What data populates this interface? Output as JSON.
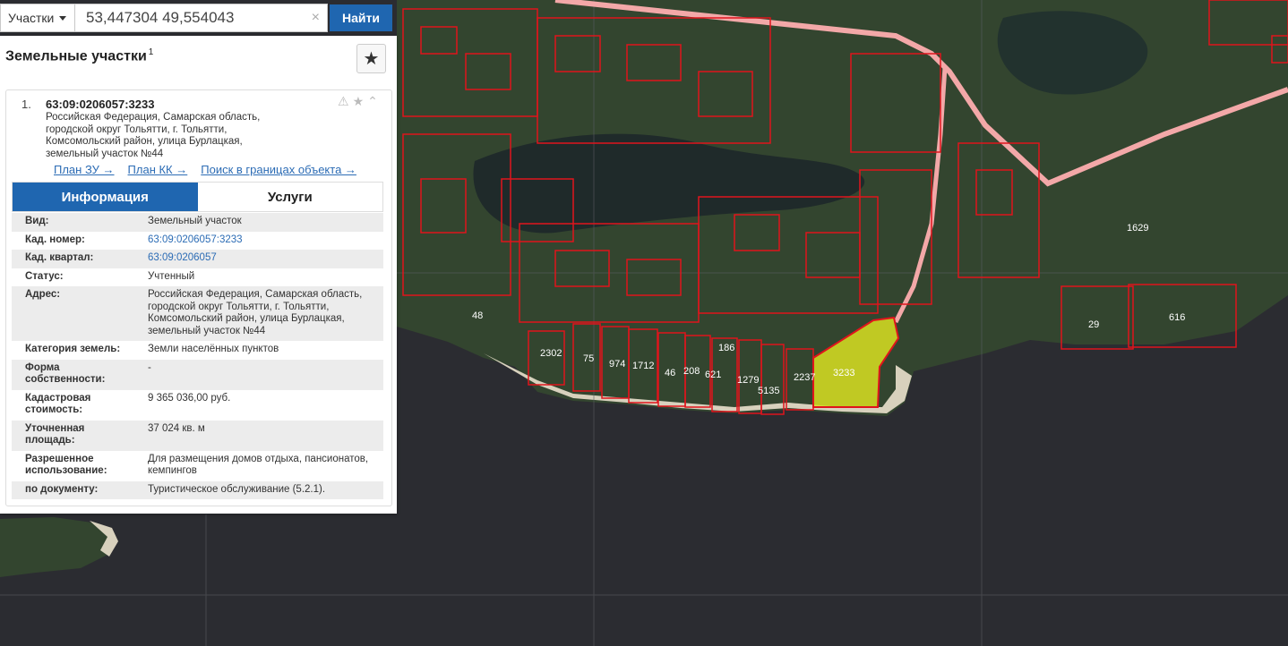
{
  "search": {
    "type_label": "Участки",
    "query": "53,447304 49,554043",
    "clear_symbol": "×",
    "button_label": "Найти"
  },
  "panel": {
    "title": "Земельные участки",
    "title_sup": "1",
    "favorite_icon": "star-icon"
  },
  "result": {
    "number": "1.",
    "cad_id": "63:09:0206057:3233",
    "address": "Российская Федерация, Самарская область, городской округ Тольятти, г. Тольятти, Комсомольский район, улица Бурлацкая, земельный участок №44",
    "icons": [
      "warning-icon",
      "star-icon",
      "chevron-up-icon"
    ],
    "links": {
      "plan_zu": "План ЗУ →",
      "plan_kk": "План КК →",
      "search_bounds": "Поиск в границах объекта →"
    }
  },
  "tabs": {
    "info": "Информация",
    "services": "Услуги"
  },
  "info_rows": [
    {
      "label": "Вид:",
      "value": "Земельный участок",
      "link": false
    },
    {
      "label": "Кад. номер:",
      "value": "63:09:0206057:3233",
      "link": true
    },
    {
      "label": "Кад. квартал:",
      "value": "63:09:0206057",
      "link": true
    },
    {
      "label": "Статус:",
      "value": "Учтенный",
      "link": false
    },
    {
      "label": "Адрес:",
      "value": "Российская Федерация, Самарская область, городской округ Тольятти, г. Тольятти, Комсомольский район, улица Бурлацкая, земельный участок №44",
      "link": false
    },
    {
      "label": "Категория земель:",
      "value": "Земли населённых пунктов",
      "link": false
    },
    {
      "label": "Форма собственности:",
      "value": "-",
      "link": false
    },
    {
      "label": "Кадастровая стоимость:",
      "value": "9 365 036,00 руб.",
      "link": false
    },
    {
      "label": "Уточненная площадь:",
      "value": "37 024 кв. м",
      "link": false
    },
    {
      "label": "Разрешенное использование:",
      "value": "Для размещения домов отдыха, пансионатов, кемпингов",
      "link": false
    },
    {
      "label": "по документу:",
      "value": "Туристическое обслуживание (5.2.1).",
      "link": false
    }
  ],
  "map": {
    "parcel_labels": [
      "1629",
      "616",
      "29",
      "48",
      "2302",
      "75",
      "974",
      "1712",
      "46",
      "208",
      "621",
      "186",
      "1279",
      "5135",
      "2237",
      "3233"
    ],
    "colors": {
      "water": "#2b2c31",
      "forest": "#2f4a2c",
      "parcel_outline": "#e0141c",
      "selected_fill": "#d9e021",
      "road": "#f3a8a8",
      "beach": "#e8e2d0"
    }
  }
}
